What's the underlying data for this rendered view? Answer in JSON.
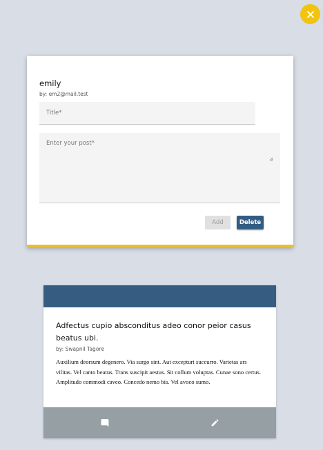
{
  "close_icon": "close-icon",
  "editor": {
    "name": "emily",
    "email": "by: em2@mail.test",
    "title_placeholder": "Title*",
    "post_placeholder": "Enter your post*",
    "add_label": "Add",
    "delete_label": "Delete"
  },
  "post": {
    "title": "Adfectus cupio absconditus adeo conor peior casus beatus ubi.",
    "author": "by: Swapnil Tagore",
    "body": "Auxilium deorsum degenero. Via surgo sint. Aut excepturi succurro. Varietas ars vilitas. Vel canto beatus. Trans suscipit aestus. Sit collum voluptas. Cunae sono certus. Amplitudo commodi caveo. Concedo nemo bis. Vel avoco sumo.",
    "footer_icons": [
      "comment-icon",
      "edit-icon"
    ]
  },
  "colors": {
    "background": "#d8dde6",
    "accent_yellow": "#f1c40f",
    "primary_blue": "#335c83",
    "footer_gray": "#969fa3"
  }
}
